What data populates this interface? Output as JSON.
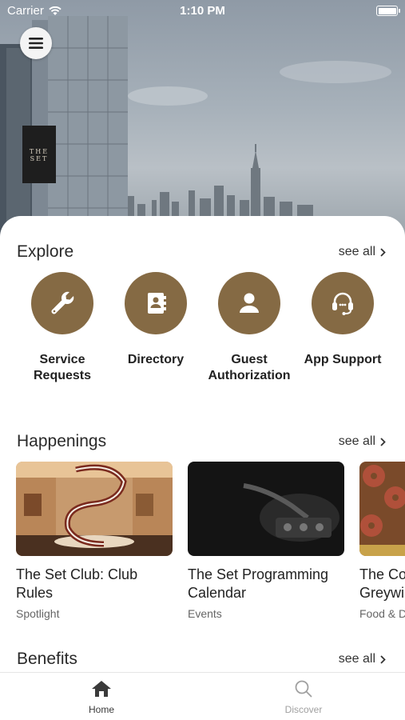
{
  "status_bar": {
    "carrier": "Carrier",
    "time": "1:10 PM"
  },
  "hero": {
    "building_sign": "THE SET"
  },
  "explore": {
    "title": "Explore",
    "see_all": "see all",
    "items": [
      {
        "label": "Service Requests",
        "icon": "wrench-icon"
      },
      {
        "label": "Directory",
        "icon": "address-book-icon"
      },
      {
        "label": "Guest Authorization",
        "icon": "person-icon"
      },
      {
        "label": "App Support",
        "icon": "headset-icon"
      }
    ]
  },
  "happenings": {
    "title": "Happenings",
    "see_all": "see all",
    "cards": [
      {
        "title": "The Set Club: Club Rules",
        "category": "Spotlight"
      },
      {
        "title": "The Set Programming Calendar",
        "category": "Events"
      },
      {
        "title": "The Co Greywi",
        "category": "Food & D"
      }
    ]
  },
  "benefits": {
    "title": "Benefits",
    "see_all": "see all"
  },
  "tabbar": {
    "active_color": "#3a3a3a",
    "inactive_color": "#a0a0a0",
    "tabs": [
      {
        "label": "Home",
        "icon": "home-icon"
      },
      {
        "label": "Discover",
        "icon": "search-icon"
      }
    ]
  },
  "colors": {
    "accent": "#856a44"
  }
}
